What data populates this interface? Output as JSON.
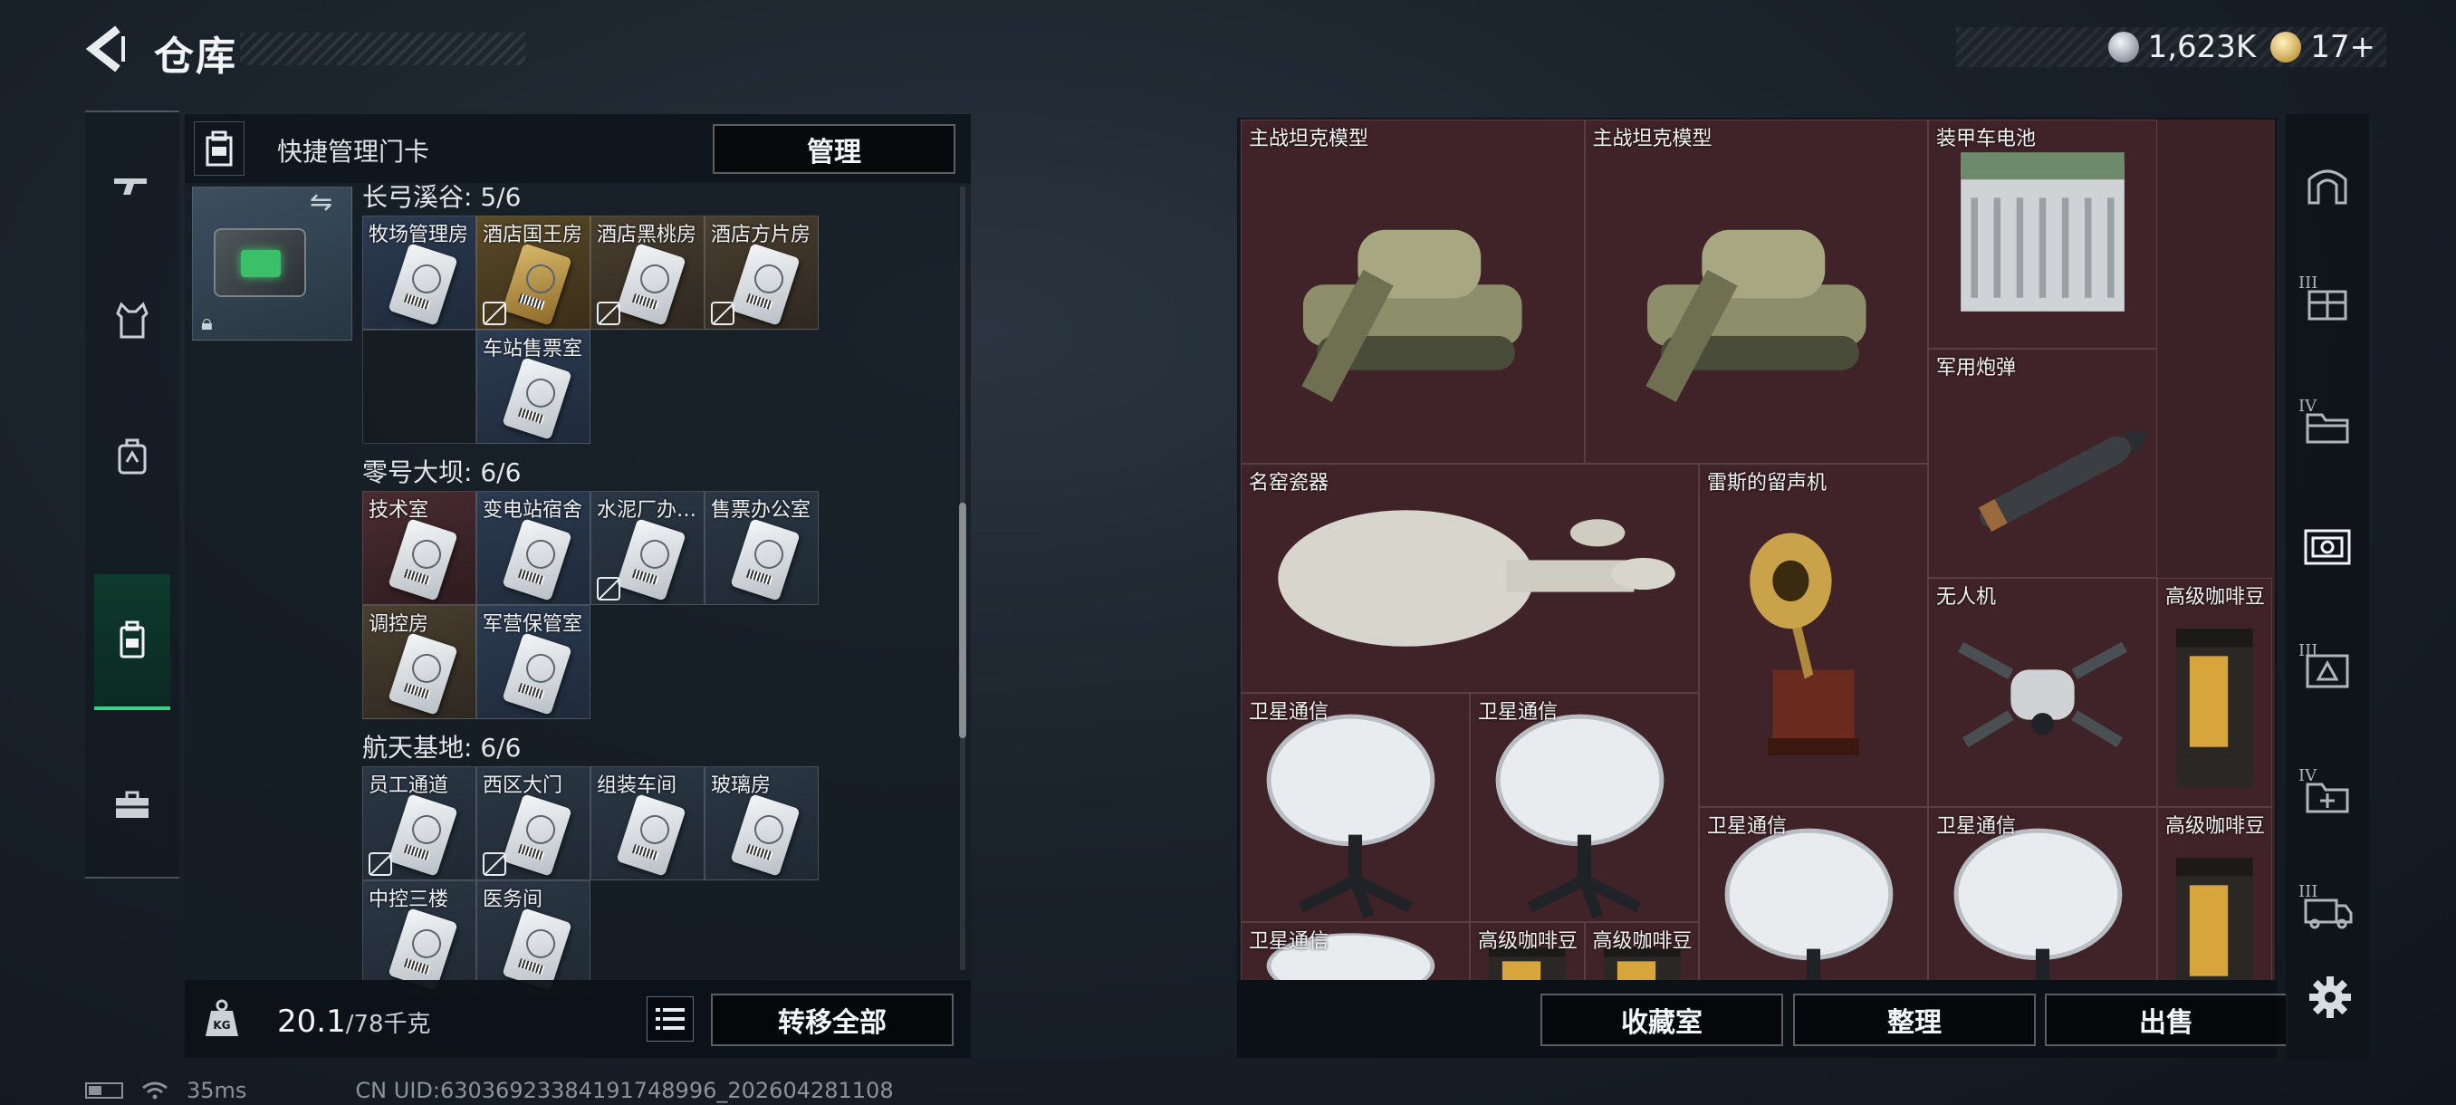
{
  "header": {
    "title": "仓库",
    "back_icon": "back-arrow-icon"
  },
  "currency": {
    "silver_value": "1,623K",
    "gold_value": "17+",
    "silver_icon": "silver-coin-icon",
    "gold_icon": "gold-coin-icon"
  },
  "left_rail": {
    "tabs": [
      {
        "icon": "gun-icon"
      },
      {
        "icon": "vest-icon"
      },
      {
        "icon": "backpack-icon"
      },
      {
        "icon": "keycard-icon",
        "active": true
      },
      {
        "icon": "toolbox-icon"
      }
    ]
  },
  "keycard_panel": {
    "title": "快捷管理门卡",
    "manage_label": "管理",
    "sections": [
      {
        "title": "长弓溪谷: 5/6",
        "cards": [
          {
            "label": "牧场管理房",
            "tone": "blue"
          },
          {
            "label": "酒店国王房",
            "tone": "gold",
            "restricted": true
          },
          {
            "label": "酒店黑桃房",
            "tone": "brown",
            "restricted": true
          },
          {
            "label": "酒店方片房",
            "tone": "brown",
            "restricted": true
          },
          {
            "label": "",
            "tone": "empty"
          },
          {
            "label": "车站售票室",
            "tone": "blue"
          }
        ]
      },
      {
        "title": "零号大坝: 6/6",
        "cards": [
          {
            "label": "技术室",
            "tone": "red"
          },
          {
            "label": "变电站宿舍",
            "tone": "blue"
          },
          {
            "label": "水泥厂办…",
            "tone": "normal",
            "restricted": true
          },
          {
            "label": "售票办公室",
            "tone": "normal"
          },
          {
            "label": "调控房",
            "tone": "brown"
          },
          {
            "label": "军营保管室",
            "tone": "blue"
          }
        ]
      },
      {
        "title": "航天基地: 6/6",
        "cards": [
          {
            "label": "员工通道",
            "tone": "normal",
            "restricted": true
          },
          {
            "label": "西区大门",
            "tone": "normal",
            "restricted": true
          },
          {
            "label": "组装车间",
            "tone": "normal"
          },
          {
            "label": "玻璃房",
            "tone": "normal"
          },
          {
            "label": "中控三楼",
            "tone": "normal"
          },
          {
            "label": "医务间",
            "tone": "normal"
          }
        ]
      }
    ]
  },
  "weight": {
    "current": "20.1",
    "max": "/78千克"
  },
  "left_actions": {
    "transfer_label": "转移全部"
  },
  "storage_items": [
    {
      "label": "主战坦克模型",
      "art": "tank"
    },
    {
      "label": "主战坦克模型",
      "art": "tank"
    },
    {
      "label": "装甲车电池",
      "art": "battery"
    },
    {
      "label": "军用炮弹",
      "art": "missile"
    },
    {
      "label": "名窑瓷器",
      "art": "vase"
    },
    {
      "label": "雷斯的留声机",
      "art": "gramophone"
    },
    {
      "label": "无人机",
      "art": "drone"
    },
    {
      "label": "高级咖啡豆",
      "art": "coffee"
    },
    {
      "label": "卫星通信",
      "art": "dish"
    },
    {
      "label": "卫星通信",
      "art": "dish"
    },
    {
      "label": "卫星通信",
      "art": "dish"
    },
    {
      "label": "卫星通信",
      "art": "dish"
    },
    {
      "label": "高级咖啡豆",
      "art": "coffee"
    },
    {
      "label": "卫星通信",
      "art": "dish"
    },
    {
      "label": "高级咖啡豆",
      "art": "coffee"
    },
    {
      "label": "高级咖啡豆",
      "art": "coffee"
    }
  ],
  "right_actions": {
    "collection_label": "收藏室",
    "sort_label": "整理",
    "sell_label": "出售"
  },
  "right_rail": {
    "tabs": [
      {
        "icon": "storage-arch-icon",
        "roman": ""
      },
      {
        "icon": "storage-crate-icon",
        "roman": "III"
      },
      {
        "icon": "storage-folder-icon",
        "roman": "IV"
      },
      {
        "icon": "storage-collection-icon",
        "roman": "",
        "active": true
      },
      {
        "icon": "storage-triangle-icon",
        "roman": "III"
      },
      {
        "icon": "storage-add-icon",
        "roman": "IV"
      },
      {
        "icon": "storage-truck-icon",
        "roman": "III"
      }
    ],
    "settings_icon": "gear-icon"
  },
  "status": {
    "ping": "35ms",
    "uid": "CN UID:6303692338419174899​6_202604281108"
  }
}
